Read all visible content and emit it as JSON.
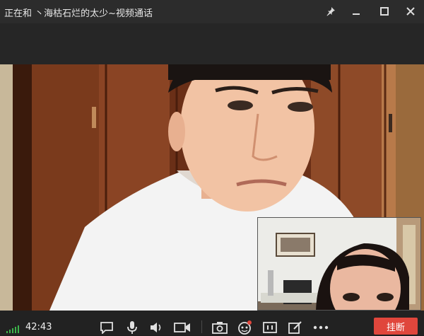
{
  "window": {
    "title": "正在和 丶海枯石烂的太少~视频通话",
    "buttons": [
      "pin-icon",
      "minimize-icon",
      "maximize-icon",
      "close-icon"
    ]
  },
  "call": {
    "duration": "42:43",
    "signal_icon": "signal-bars-icon",
    "hangup_label": "挂断",
    "hangup_color": "#e0463c"
  },
  "toolbar": {
    "icons": [
      "chat-icon",
      "microphone-icon",
      "speaker-icon",
      "camera-icon",
      "screenshot-icon",
      "effects-icon",
      "layout-icon",
      "edit-icon",
      "more-icon"
    ]
  },
  "colors": {
    "titlebar": "#2c2c2c",
    "bottombar": "#222222",
    "accent_red": "#e0463c"
  }
}
